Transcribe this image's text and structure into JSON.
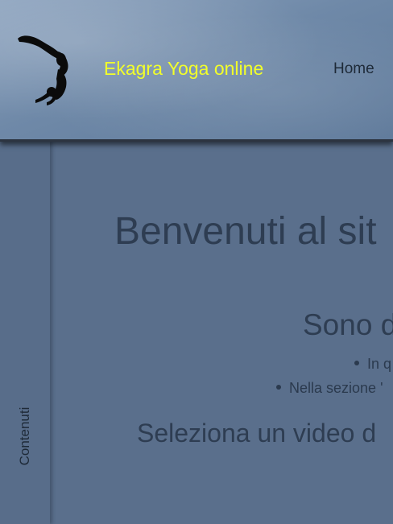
{
  "header": {
    "logo": "yoga-pose-silhouette-icon",
    "site_title": "Ekagra Yoga online",
    "nav": {
      "home": "Home"
    }
  },
  "sidebar": {
    "label": "Contenuti"
  },
  "main": {
    "heading": "Benvenuti al sit",
    "subheading": "Sono d",
    "bullets": [
      "In q",
      "Nella sezione '"
    ],
    "prompt": "Seleziona un video d"
  },
  "colors": {
    "background": "#5a6f8c",
    "title_yellow": "#f2ff2a",
    "text_dark": "#2e3d52"
  }
}
